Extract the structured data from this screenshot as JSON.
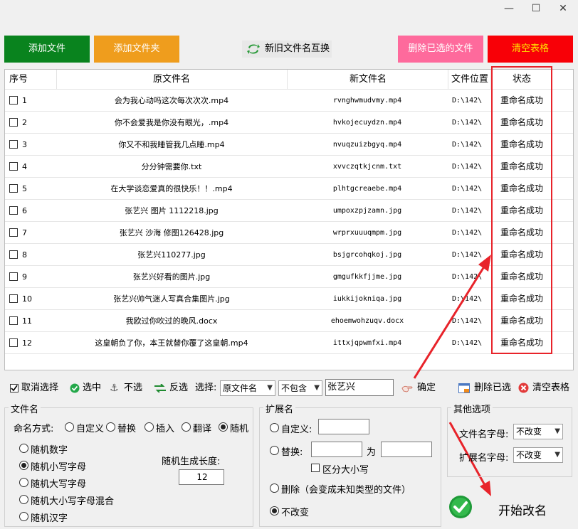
{
  "window": {
    "minimize": "—",
    "maximize": "☐",
    "close": "✕"
  },
  "toolbar": {
    "add_file": "添加文件",
    "add_folder": "添加文件夹",
    "swap_names": "新旧文件名互换",
    "delete_selected": "删除已选的文件",
    "clear_table": "清空表格"
  },
  "colors": {
    "green": "#09831e",
    "orange": "#ef9d1d",
    "pink": "#fe6a9c",
    "red": "#f80007",
    "annotation_red": "#e8232a"
  },
  "table": {
    "headers": {
      "seq": "序号",
      "original": "原文件名",
      "new": "新文件名",
      "location": "文件位置",
      "status": "状态"
    },
    "rows": [
      {
        "seq": "1",
        "original": "会为我心动吗这次每次次次.mp4",
        "new": "rvnghwmudvmy.mp4",
        "location": "D:\\142\\",
        "status": "重命名成功"
      },
      {
        "seq": "2",
        "original": "你不会爱我是你没有眼光，.mp4",
        "new": "hvkojecuydzn.mp4",
        "location": "D:\\142\\",
        "status": "重命名成功"
      },
      {
        "seq": "3",
        "original": "你又不和我睡管我几点睡.mp4",
        "new": "nvuqzuizbgyq.mp4",
        "location": "D:\\142\\",
        "status": "重命名成功"
      },
      {
        "seq": "4",
        "original": "分分钟需要你.txt",
        "new": "xvvczqtkjcnm.txt",
        "location": "D:\\142\\",
        "status": "重命名成功"
      },
      {
        "seq": "5",
        "original": "在大学谈恋爱真的很快乐！！.mp4",
        "new": "plhtgcreaebe.mp4",
        "location": "D:\\142\\",
        "status": "重命名成功"
      },
      {
        "seq": "6",
        "original": "张艺兴 图片 1112218.jpg",
        "new": "umpoxzpjzamn.jpg",
        "location": "D:\\142\\",
        "status": "重命名成功"
      },
      {
        "seq": "7",
        "original": "张艺兴 沙海 修图126428.jpg",
        "new": "wrprxuuuqmpm.jpg",
        "location": "D:\\142\\",
        "status": "重命名成功"
      },
      {
        "seq": "8",
        "original": "张艺兴110277.jpg",
        "new": "bsjgrcohqkoj.jpg",
        "location": "D:\\142\\",
        "status": "重命名成功"
      },
      {
        "seq": "9",
        "original": "张艺兴好看的图片.jpg",
        "new": "gmgufkkfjjme.jpg",
        "location": "D:\\142\\",
        "status": "重命名成功"
      },
      {
        "seq": "10",
        "original": "张艺兴帅气迷人写真合集图片.jpg",
        "new": "iukkijokniqa.jpg",
        "location": "D:\\142\\",
        "status": "重命名成功"
      },
      {
        "seq": "11",
        "original": "我欧过你吹过的晚风.docx",
        "new": "ehoemwohzuqv.docx",
        "location": "D:\\142\\",
        "status": "重命名成功"
      },
      {
        "seq": "12",
        "original": "这皇朝负了你，本王就替你覆了这皇朝.mp4",
        "new": "ittxjqpwmfxi.mp4",
        "location": "D:\\142\\",
        "status": "重命名成功"
      }
    ]
  },
  "selection": {
    "deselect": "取消选择",
    "select": "选中",
    "unselect": "不选",
    "invert": "反选",
    "choose_label": "选择:",
    "field": "原文件名",
    "condition": "不包含",
    "keyword": "张艺兴",
    "confirm": "确定",
    "delete_selected": "删除已选",
    "clear_table": "清空表格"
  },
  "filename_group": {
    "title": "文件名",
    "mode_label": "命名方式:",
    "modes": [
      "自定义",
      "替换",
      "插入",
      "翻译",
      "随机"
    ],
    "selected_mode": "随机",
    "random_options": [
      "随机数字",
      "随机小写字母",
      "随机大写字母",
      "随机大小写字母混合",
      "随机汉字"
    ],
    "selected_random": "随机小写字母",
    "length_label": "随机生成长度:",
    "length_value": "12"
  },
  "extension_group": {
    "title": "扩展名",
    "custom": "自定义:",
    "replace": "替换:",
    "to": "为",
    "case_sensitive": "区分大小写",
    "delete": "删除（会变成未知类型的文件）",
    "unchanged": "不改变",
    "selected": "不改变"
  },
  "other_group": {
    "title": "其他选项",
    "name_case_label": "文件名字母:",
    "name_case_value": "不改变",
    "ext_case_label": "扩展名字母:",
    "ext_case_value": "不改变"
  },
  "start": {
    "label": "开始改名"
  }
}
